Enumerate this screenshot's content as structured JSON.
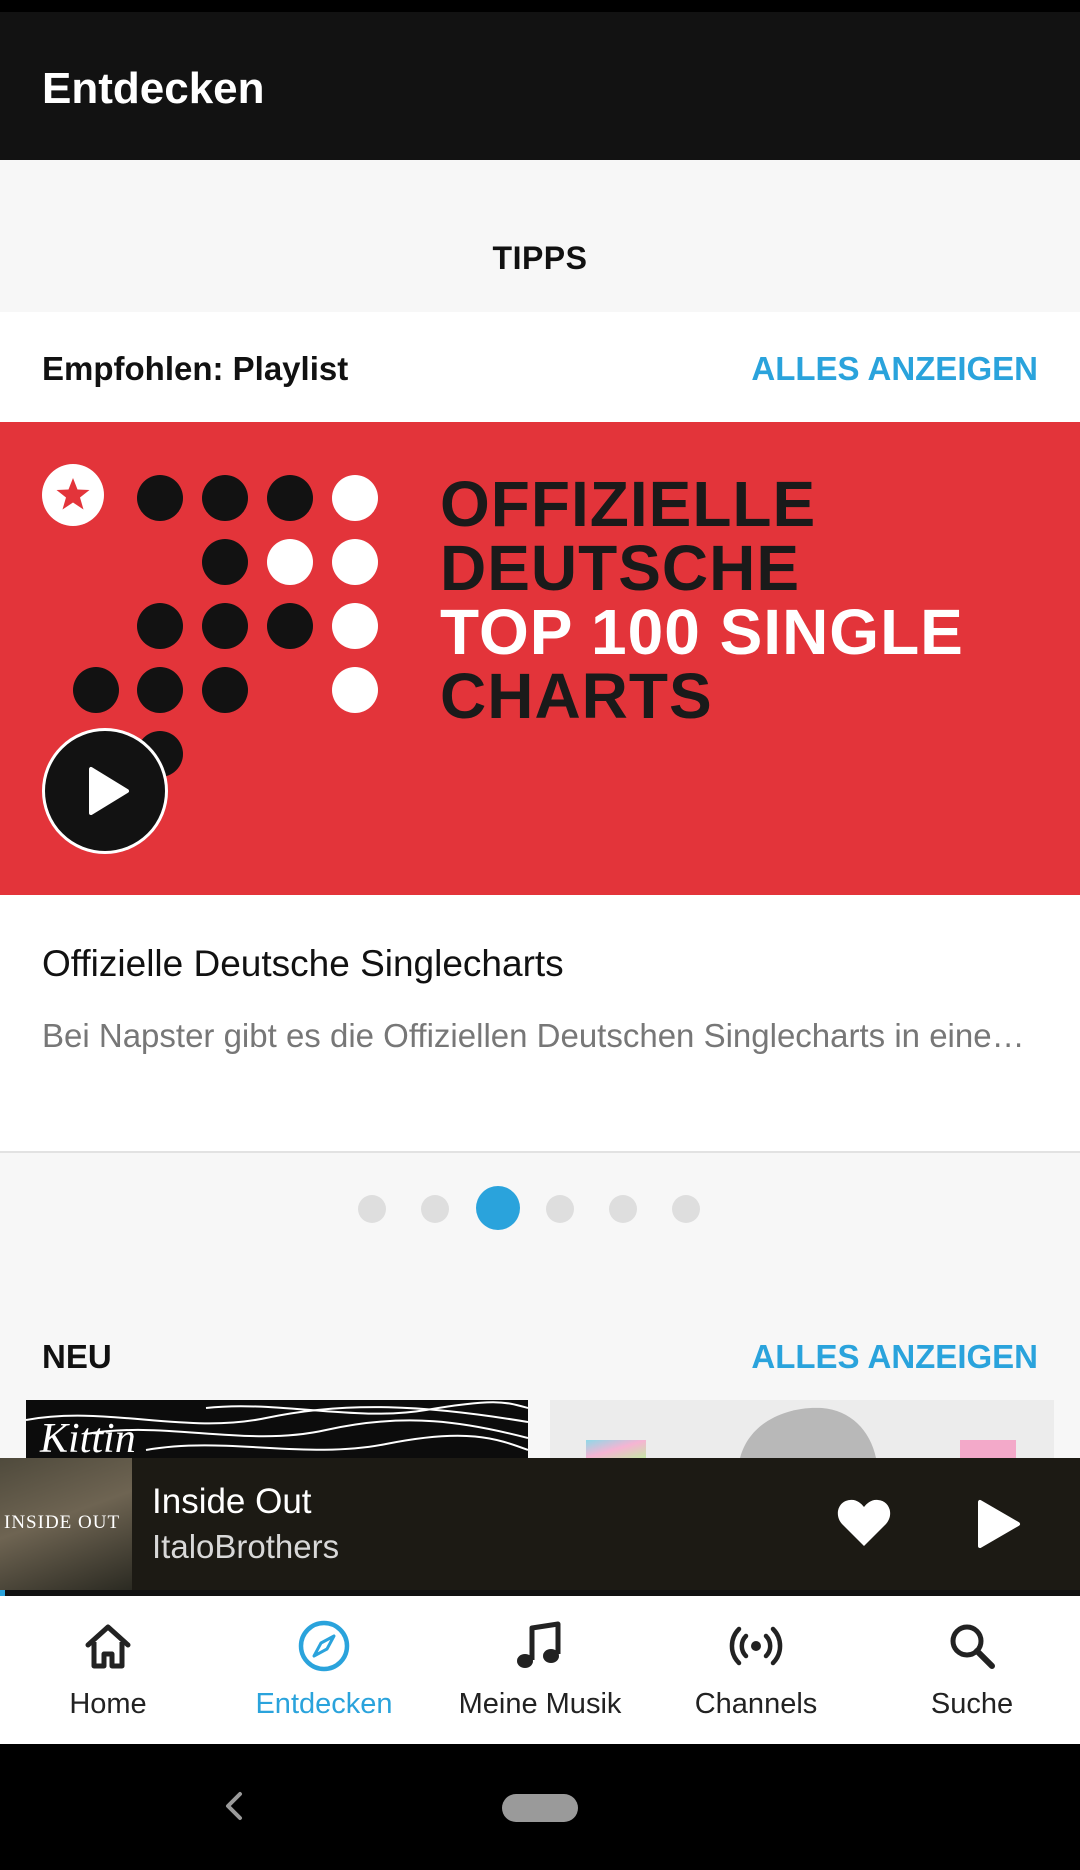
{
  "app_bar": {
    "title": "Entdecken"
  },
  "tabs": {
    "active": "TIPPS"
  },
  "featured_section": {
    "title": "Empfohlen: Playlist",
    "see_all": "ALLES ANZEIGEN",
    "banner_lines": [
      "OFFIZIELLE",
      "DEUTSCHE",
      "TOP 100 SINGLE",
      "CHARTS"
    ],
    "card_title": "Offizielle Deutsche Singlecharts",
    "card_description": "Bei Napster gibt es die Offiziellen Deutschen Singlecharts in eine…"
  },
  "pager": {
    "count": 6,
    "active_index": 2
  },
  "new_section": {
    "title": "NEU",
    "see_all": "ALLES ANZEIGEN",
    "album_1_art_text": "Kittin"
  },
  "mini_player": {
    "title": "Inside Out",
    "artist": "ItaloBrothers",
    "art_text": "INSIDE OUT",
    "progress_fraction": 0.005
  },
  "bottom_nav": {
    "items": [
      {
        "label": "Home",
        "icon": "home-icon"
      },
      {
        "label": "Entdecken",
        "icon": "compass-icon",
        "active": true
      },
      {
        "label": "Meine Musik",
        "icon": "music-note-icon"
      },
      {
        "label": "Channels",
        "icon": "broadcast-icon"
      },
      {
        "label": "Suche",
        "icon": "search-icon"
      }
    ]
  },
  "colors": {
    "accent": "#2aa3dc",
    "banner": "#e3343a",
    "app_bar": "#121212",
    "player": "#1c1a14"
  }
}
